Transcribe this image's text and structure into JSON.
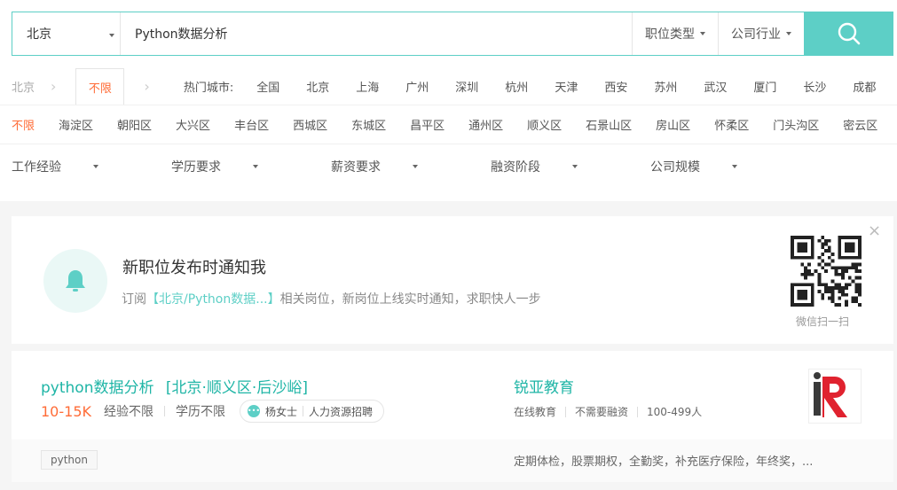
{
  "search": {
    "city": "北京",
    "keyword": "Python数据分析",
    "filter1": "职位类型",
    "filter2": "公司行业"
  },
  "city_row": {
    "current": "北京",
    "unlimited": "不限",
    "hot_label": "热门城市:",
    "cities": [
      "全国",
      "北京",
      "上海",
      "广州",
      "深圳",
      "杭州",
      "天津",
      "西安",
      "苏州",
      "武汉",
      "厦门",
      "长沙",
      "成都"
    ]
  },
  "district_row": {
    "items": [
      "不限",
      "海淀区",
      "朝阳区",
      "大兴区",
      "丰台区",
      "西城区",
      "东城区",
      "昌平区",
      "通州区",
      "顺义区",
      "石景山区",
      "房山区",
      "怀柔区",
      "门头沟区",
      "密云区"
    ]
  },
  "filters": {
    "items": [
      "工作经验",
      "学历要求",
      "薪资要求",
      "融资阶段",
      "公司规模"
    ]
  },
  "notify": {
    "title": "新职位发布时通知我",
    "sub_prefix": "订阅",
    "sub_highlight": "【北京/Python数据...】",
    "sub_suffix": "相关岗位，新岗位上线实时通知，求职快人一步",
    "qr_label": "微信扫一扫"
  },
  "job": {
    "title": "python数据分析",
    "location": "[北京·顺义区·后沙峪]",
    "salary": "10-15K",
    "experience": "经验不限",
    "education": "学历不限",
    "recruiter": "杨女士",
    "recruiter_role": "人力资源招聘",
    "company": "锐亚教育",
    "company_type": "在线教育",
    "funding": "不需要融资",
    "size": "100-499人",
    "tag": "python",
    "benefits": "定期体检，股票期权，全勤奖，补充医疗保险，年终奖，..."
  },
  "colors": {
    "accent": "#5dcfc6",
    "orange": "#ff6c37",
    "teal_text": "#1fb5a6"
  }
}
